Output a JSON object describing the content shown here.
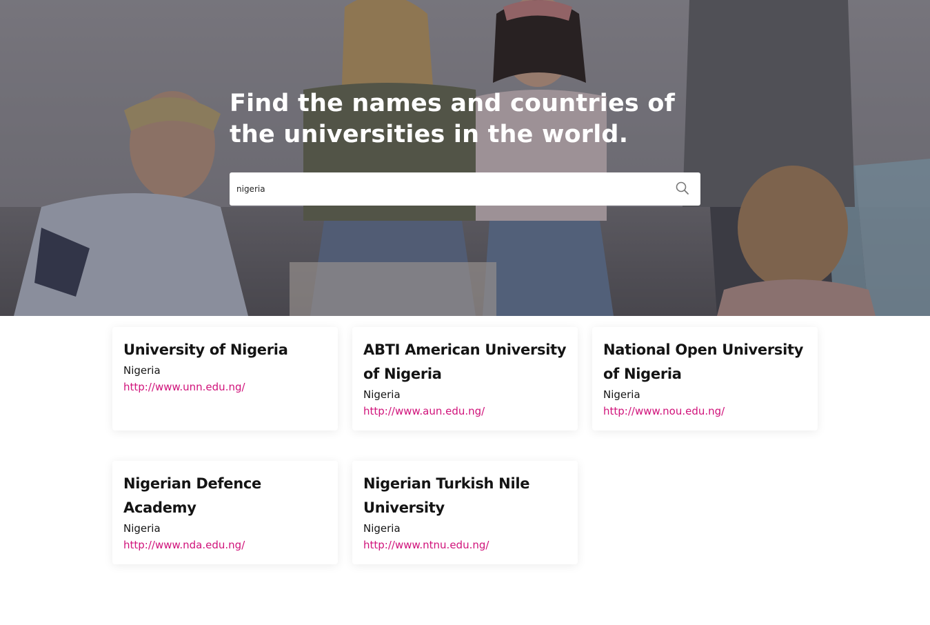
{
  "hero": {
    "title": "Find the names and countries of the universities in the world.",
    "search": {
      "value": "nigeria",
      "icon": "search-icon"
    }
  },
  "results": [
    {
      "name": "University of Nigeria",
      "country": "Nigeria",
      "url": "http://www.unn.edu.ng/"
    },
    {
      "name": "ABTI American University of Nigeria",
      "country": "Nigeria",
      "url": "http://www.aun.edu.ng/"
    },
    {
      "name": "National Open University of Nigeria",
      "country": "Nigeria",
      "url": "http://www.nou.edu.ng/"
    },
    {
      "name": "Nigerian Defence Academy",
      "country": "Nigeria",
      "url": "http://www.nda.edu.ng/"
    },
    {
      "name": "Nigerian Turkish Nile University",
      "country": "Nigeria",
      "url": "http://www.ntnu.edu.ng/"
    }
  ],
  "colors": {
    "link": "#d0127a",
    "text": "#141414",
    "card_background": "#ffffff"
  }
}
